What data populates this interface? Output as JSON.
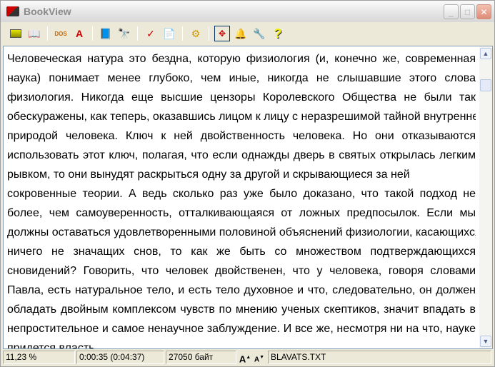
{
  "window": {
    "title": "BookView"
  },
  "toolbar": {
    "buttons": [
      "open-folder",
      "open-book",
      "dos-win-encoding",
      "font-settings",
      "bookmarks",
      "find",
      "goto",
      "print",
      "options",
      "fullscreen",
      "alarm",
      "tools",
      "help"
    ]
  },
  "content": {
    "lines": [
      "Человеческая натура это бездна, которую физиология (и, конечно же, современная",
      "наука) понимает менее глубоко, чем иные, никогда не слышавшие этого слова",
      "физиология. Никогда еще высшие цензоры Королевского Общества не были так",
      "обескуражены, как теперь, оказавшись лицом к лицу с неразрешимой тайной внутренней",
      "природой человека. Ключ к ней двойственность человека. Но они отказываются",
      "использовать этот ключ, полагая, что если однажды дверь в святых открылась легким",
      "рывком, то они вынудят раскрыться одну за другой и скрывающиеся за ней",
      "сокровенные теории. А ведь сколько раз уже было доказано, что такой подход не",
      "более, чем самоуверенность, отталкивающаяся от ложных предпосылок. Если мы",
      "должны оставаться удовлетворенными половиной объяснений физиологии, касающихся",
      "ничего не значащих снов, то как же быть со множеством подтверждающихся",
      "сновидений? Говорить, что человек двойственен, что у человека, говоря словами",
      "Павла, есть натуральное тело, и есть тело духовное и что, следовательно, он должен",
      "обладать двойным комплексом чувств по мнению ученых скептиков, значит впадать в",
      "непростительное и самое ненаучное заблуждение. И все же, несмотря ни на что, науке",
      "придется власть"
    ]
  },
  "status": {
    "percent": "11,23 %",
    "time": "0:00:35  (0:04:37)",
    "size": "27050 байт",
    "font_up": "A",
    "font_down": "A",
    "file": "BLAVATS.TXT"
  }
}
